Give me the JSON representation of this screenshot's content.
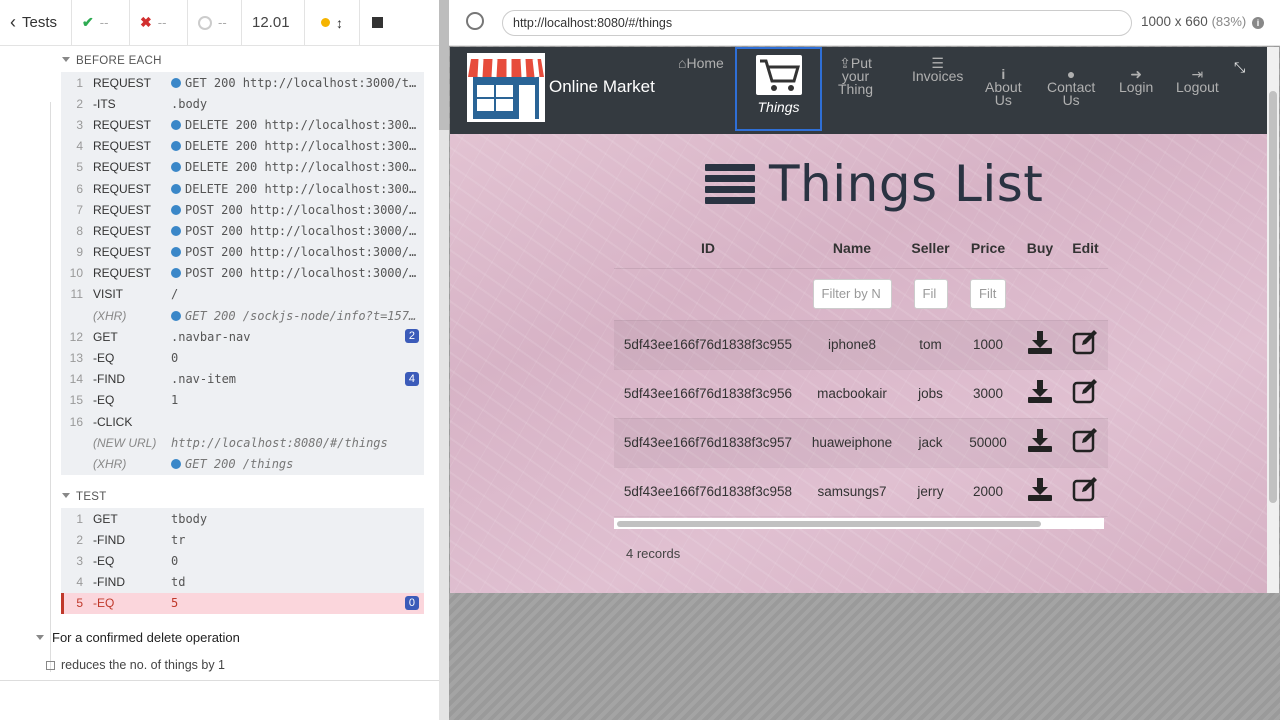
{
  "runner": {
    "back_label": "Tests",
    "passed": "--",
    "failed": "--",
    "pending": "--",
    "duration": "12.01",
    "colors": {
      "accent": "#3b5bb9",
      "fail": "#c0392b",
      "dot": "#3a87c8"
    }
  },
  "before_each": {
    "title": "BEFORE EACH",
    "commands": [
      {
        "n": "1",
        "name": "REQUEST",
        "msg": "GET 200 http://localhost:3000/things",
        "dot": true
      },
      {
        "n": "2",
        "name": "-ITS",
        "msg": ".body"
      },
      {
        "n": "3",
        "name": "REQUEST",
        "msg": "DELETE 200 http://localhost:3000/things",
        "dot": true
      },
      {
        "n": "4",
        "name": "REQUEST",
        "msg": "DELETE 200 http://localhost:3000/things",
        "dot": true
      },
      {
        "n": "5",
        "name": "REQUEST",
        "msg": "DELETE 200 http://localhost:3000/things",
        "dot": true
      },
      {
        "n": "6",
        "name": "REQUEST",
        "msg": "DELETE 200 http://localhost:3000/things",
        "dot": true
      },
      {
        "n": "7",
        "name": "REQUEST",
        "msg": "POST 200 http://localhost:3000/things",
        "dot": true
      },
      {
        "n": "8",
        "name": "REQUEST",
        "msg": "POST 200 http://localhost:3000/things",
        "dot": true
      },
      {
        "n": "9",
        "name": "REQUEST",
        "msg": "POST 200 http://localhost:3000/things",
        "dot": true
      },
      {
        "n": "10",
        "name": "REQUEST",
        "msg": "POST 200 http://localhost:3000/things",
        "dot": true
      },
      {
        "n": "11",
        "name": "VISIT",
        "msg": "/"
      },
      {
        "n": "",
        "name": "(XHR)",
        "msg": "GET 200 /sockjs-node/info?t=1576...",
        "dot": true,
        "italic": true
      },
      {
        "n": "12",
        "name": "GET",
        "msg": ".navbar-nav",
        "badge": "2"
      },
      {
        "n": "13",
        "name": "-EQ",
        "msg": "0"
      },
      {
        "n": "14",
        "name": "-FIND",
        "msg": ".nav-item",
        "badge": "4"
      },
      {
        "n": "15",
        "name": "-EQ",
        "msg": "1"
      },
      {
        "n": "16",
        "name": "-CLICK",
        "msg": ""
      },
      {
        "n": "",
        "name": "(NEW URL)",
        "msg": "http://localhost:8080/#/things",
        "italic": true
      },
      {
        "n": "",
        "name": "(XHR)",
        "msg": "GET 200 /things",
        "dot": true,
        "italic": true
      }
    ]
  },
  "test": {
    "title": "TEST",
    "commands": [
      {
        "n": "1",
        "name": "GET",
        "msg": "tbody"
      },
      {
        "n": "2",
        "name": "-FIND",
        "msg": "tr"
      },
      {
        "n": "3",
        "name": "-EQ",
        "msg": "0"
      },
      {
        "n": "4",
        "name": "-FIND",
        "msg": "td"
      },
      {
        "n": "5",
        "name": "-EQ",
        "msg": "5",
        "badge": "0",
        "fail": true
      }
    ]
  },
  "suite_title": "For a confirmed delete operation",
  "test_title": "reduces the no. of things by 1",
  "browser": {
    "url": "http://localhost:8080/#/things",
    "viewport": "1000 x 660",
    "zoom": "(83%)"
  },
  "app": {
    "brand": "Online Market",
    "nav": {
      "home": "Home",
      "things": "Things",
      "put_thing": [
        "Put",
        "your",
        "Thing"
      ],
      "invoices": "Invoices",
      "about": [
        "About",
        "Us"
      ],
      "contact": [
        "Contact",
        "Us"
      ],
      "login": "Login",
      "logout": "Logout"
    },
    "page_title": "Things List",
    "columns": [
      "ID",
      "Name",
      "Seller",
      "Price",
      "Buy",
      "Edit"
    ],
    "filters": [
      "Filter by N",
      "Fil",
      "Filt"
    ],
    "rows": [
      {
        "id": "5df43ee166f76d1838f3c955",
        "name": "iphone8",
        "seller": "tom",
        "price": "1000"
      },
      {
        "id": "5df43ee166f76d1838f3c956",
        "name": "macbookair",
        "seller": "jobs",
        "price": "3000"
      },
      {
        "id": "5df43ee166f76d1838f3c957",
        "name": "huaweiphone",
        "seller": "jack",
        "price": "50000"
      },
      {
        "id": "5df43ee166f76d1838f3c958",
        "name": "samsungs7",
        "seller": "jerry",
        "price": "2000"
      }
    ],
    "records": "4 records"
  }
}
